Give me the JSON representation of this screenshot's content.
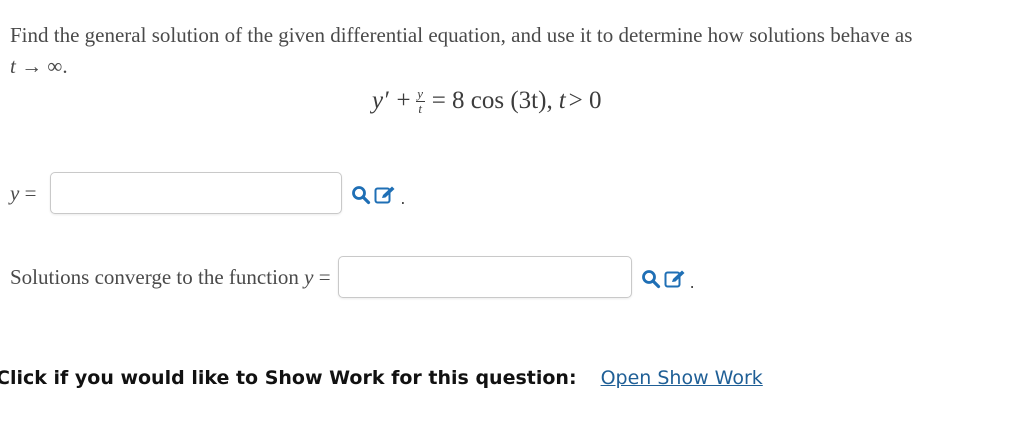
{
  "question": {
    "text": "Find the general solution of the given differential equation, and use it to determine how solutions behave as",
    "limit_var": "t",
    "limit_arrow": "→",
    "limit_target": "∞."
  },
  "equation": {
    "lhs_prime": "y′ +",
    "frac_num": "y",
    "frac_den": "t",
    "rhs": "= 8 cos (3t),",
    "cond_var": "t",
    "cond_rest": "> 0"
  },
  "answers": [
    {
      "label_var": "y",
      "label_eq": " =",
      "value": "",
      "placeholder": ""
    },
    {
      "label_text": "Solutions converge to the function ",
      "label_var": "y",
      "label_eq": " =",
      "value": "",
      "placeholder": ""
    }
  ],
  "icons": {
    "preview": "magnifier-icon",
    "edit": "edit-pencil-icon",
    "color": "#1f6fb5"
  },
  "trailing_dot": ".",
  "show_work": {
    "label": "Click if you would like to Show Work for this question:",
    "link": "Open Show Work",
    "link_color": "#1f5f96"
  }
}
